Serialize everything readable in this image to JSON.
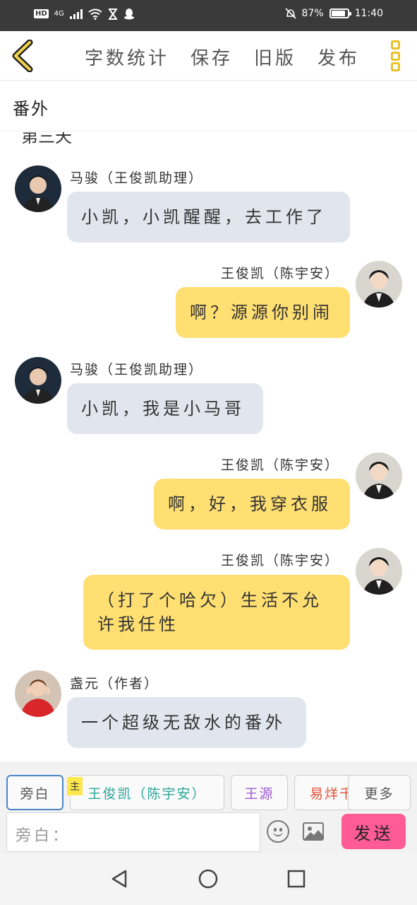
{
  "status_bar": {
    "hd": "HD",
    "network": "4G",
    "battery_text": "87%",
    "battery_level": 0.87,
    "time": "11:40"
  },
  "header": {
    "menu": [
      "字数统计",
      "保存",
      "旧版",
      "发布"
    ]
  },
  "document": {
    "title": "番外",
    "cut_text": "第三天"
  },
  "messages": [
    {
      "side": "left",
      "name": "马骏（王俊凯助理）",
      "text": "小凯，小凯醒醒，去工作了",
      "avatar": "person-avatar"
    },
    {
      "side": "right",
      "name": "王俊凯（陈宇安）",
      "text": "啊？源源你别闹",
      "avatar": "person-avatar"
    },
    {
      "side": "left",
      "name": "马骏（王俊凯助理）",
      "text": "小凯，我是小马哥",
      "avatar": "person-avatar"
    },
    {
      "side": "right",
      "name": "王俊凯（陈宇安）",
      "text": "啊，好，我穿衣服",
      "avatar": "person-avatar"
    },
    {
      "side": "right",
      "name": "王俊凯（陈宇安）",
      "text": "（打了个哈欠）生活不允许我任性",
      "avatar": "person-avatar"
    },
    {
      "side": "left",
      "name": "盏元（作者）",
      "text": "一个超级无敌水的番外",
      "avatar": "person-avatar"
    }
  ],
  "roles": {
    "narration": "旁白",
    "main_badge": "主",
    "main_role": "王俊凯（陈宇安）",
    "role2": "王源",
    "role3": "易烊千玺",
    "more": "更多"
  },
  "input": {
    "placeholder": "旁白："
  },
  "send_label": "发送",
  "colors": {
    "accent_yellow": "#ffdf72",
    "left_bubble": "#e1e6ee",
    "send_pink": "#ff5c97",
    "role_main": "#2aa69a",
    "role_wangyuan": "#9b59d0",
    "role_yiyang": "#e0523a"
  }
}
